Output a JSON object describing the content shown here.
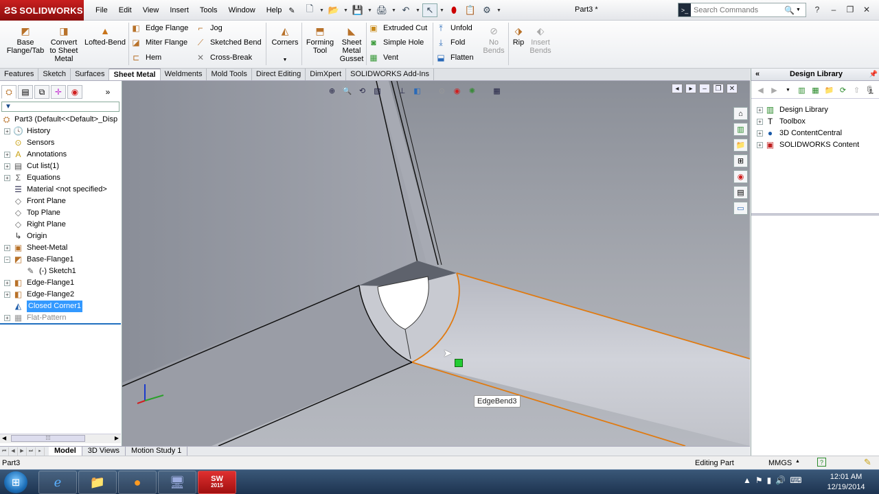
{
  "app": {
    "brand": "SOLIDWORKS",
    "document_title": "Part3 *"
  },
  "menu": [
    "File",
    "Edit",
    "View",
    "Insert",
    "Tools",
    "Window",
    "Help"
  ],
  "search": {
    "placeholder": "Search Commands"
  },
  "ribbon": {
    "base_flange": "Base\nFlange/Tab",
    "convert": "Convert\nto Sheet\nMetal",
    "lofted_bend": "Lofted-Bend",
    "edge_flange": "Edge Flange",
    "miter_flange": "Miter Flange",
    "hem": "Hem",
    "jog": "Jog",
    "sketched_bend": "Sketched Bend",
    "cross_break": "Cross-Break",
    "corners": "Corners",
    "forming_tool": "Forming\nTool",
    "gusset": "Sheet\nMetal\nGusset",
    "extruded_cut": "Extruded Cut",
    "simple_hole": "Simple Hole",
    "vent": "Vent",
    "unfold": "Unfold",
    "fold": "Fold",
    "flatten": "Flatten",
    "no_bends": "No\nBends",
    "rip": "Rip",
    "insert_bends": "Insert\nBends"
  },
  "command_tabs": [
    {
      "label": "Features",
      "active": false
    },
    {
      "label": "Sketch",
      "active": false
    },
    {
      "label": "Surfaces",
      "active": false
    },
    {
      "label": "Sheet Metal",
      "active": true
    },
    {
      "label": "Weldments",
      "active": false
    },
    {
      "label": "Mold Tools",
      "active": false
    },
    {
      "label": "Direct Editing",
      "active": false
    },
    {
      "label": "DimXpert",
      "active": false
    },
    {
      "label": "SOLIDWORKS Add-Ins",
      "active": false
    }
  ],
  "feature_tree": [
    {
      "label": "Part3  (Default<<Default>_Disp",
      "icon": "part-icon",
      "level": 0,
      "expander": false,
      "state": "normal"
    },
    {
      "label": "History",
      "icon": "history-icon",
      "level": 1,
      "expander": true,
      "state": "normal"
    },
    {
      "label": "Sensors",
      "icon": "sensors-icon",
      "level": 1,
      "expander": false,
      "state": "normal"
    },
    {
      "label": "Annotations",
      "icon": "annotations-icon",
      "level": 1,
      "expander": true,
      "state": "normal"
    },
    {
      "label": "Cut list(1)",
      "icon": "cut-list-icon",
      "level": 1,
      "expander": true,
      "state": "normal"
    },
    {
      "label": "Equations",
      "icon": "equations-icon",
      "level": 1,
      "expander": true,
      "state": "normal"
    },
    {
      "label": "Material <not specified>",
      "icon": "material-icon",
      "level": 1,
      "expander": false,
      "state": "normal"
    },
    {
      "label": "Front Plane",
      "icon": "plane-icon",
      "level": 1,
      "expander": false,
      "state": "normal"
    },
    {
      "label": "Top Plane",
      "icon": "plane-icon",
      "level": 1,
      "expander": false,
      "state": "normal"
    },
    {
      "label": "Right Plane",
      "icon": "plane-icon",
      "level": 1,
      "expander": false,
      "state": "normal"
    },
    {
      "label": "Origin",
      "icon": "origin-icon",
      "level": 1,
      "expander": false,
      "state": "normal"
    },
    {
      "label": "Sheet-Metal",
      "icon": "sheet-metal-icon",
      "level": 1,
      "expander": true,
      "state": "normal"
    },
    {
      "label": "Base-Flange1",
      "icon": "base-flange-icon",
      "level": 1,
      "expander": true,
      "expanded": true,
      "state": "normal"
    },
    {
      "label": "(-) Sketch1",
      "icon": "sketch-icon",
      "level": 2,
      "expander": false,
      "state": "normal"
    },
    {
      "label": "Edge-Flange1",
      "icon": "edge-flange-icon",
      "level": 1,
      "expander": true,
      "state": "normal"
    },
    {
      "label": "Edge-Flange2",
      "icon": "edge-flange-icon",
      "level": 1,
      "expander": true,
      "state": "normal"
    },
    {
      "label": "Closed Corner1",
      "icon": "closed-corner-icon",
      "level": 1,
      "expander": false,
      "state": "selected"
    },
    {
      "label": "Flat-Pattern",
      "icon": "flat-pattern-icon",
      "level": 1,
      "expander": true,
      "state": "suppressed"
    }
  ],
  "viewport": {
    "tooltip": "EdgeBend3"
  },
  "design_library": {
    "title": "Design Library",
    "items": [
      "Design Library",
      "Toolbox",
      "3D ContentCentral",
      "SOLIDWORKS Content"
    ]
  },
  "bottom_tabs": [
    {
      "label": "Model",
      "active": true
    },
    {
      "label": "3D Views",
      "active": false
    },
    {
      "label": "Motion Study 1",
      "active": false
    }
  ],
  "status": {
    "left": "Part3",
    "mode": "Editing Part",
    "units": "MMGS"
  },
  "taskbar": {
    "time": "12:01 AM",
    "date": "12/19/2014",
    "sw_badge": "2015"
  },
  "colors": {
    "brand_red": "#b3141a",
    "selection": "#3399ff",
    "edge_highlight": "#e07a10"
  }
}
